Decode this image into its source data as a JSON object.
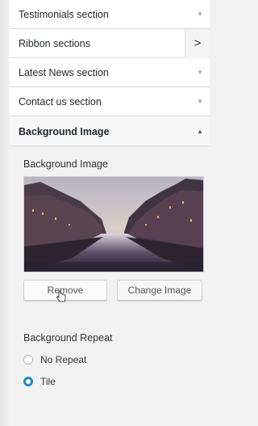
{
  "sections": [
    {
      "label": "Testimonials section",
      "indicator": "caret-down-icon"
    },
    {
      "label": "Ribbon sections",
      "indicator": "chevron-right-icon"
    },
    {
      "label": "Latest News section",
      "indicator": "caret-down-icon"
    },
    {
      "label": "Contact us section",
      "indicator": "caret-down-icon"
    },
    {
      "label": "Background Image",
      "indicator": "caret-up-icon"
    }
  ],
  "background_image": {
    "control_title": "Background Image",
    "remove_label": "Remove",
    "change_label": "Change Image"
  },
  "background_repeat": {
    "title": "Background Repeat",
    "options": [
      "No Repeat",
      "Tile"
    ],
    "selected": "Tile"
  },
  "colors": {
    "accent": "#1e8cbe",
    "panel_bg": "#f1f1f1",
    "section_bg": "#ffffff"
  }
}
